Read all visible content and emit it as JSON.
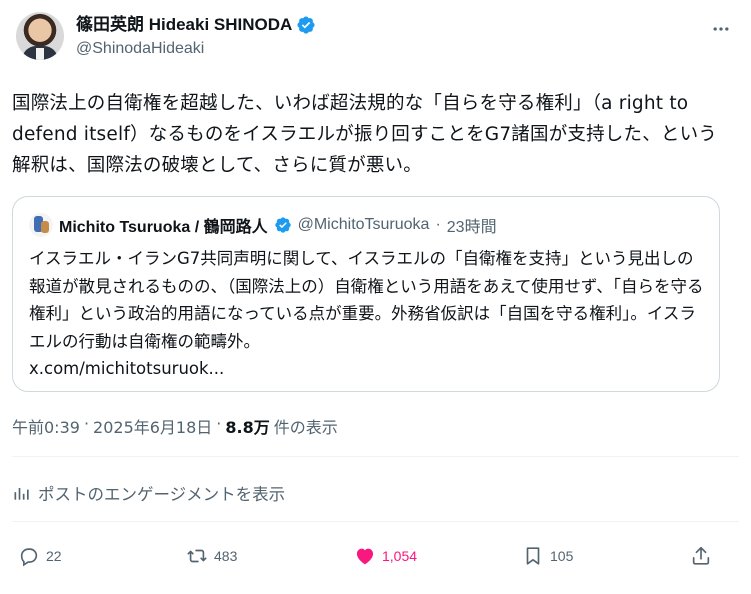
{
  "author": {
    "display_name": "篠田英朗 Hideaki SHINODA",
    "handle": "@ShinodaHideaki"
  },
  "tweet": {
    "text": "国際法上の自衛権を超越した、いわば超法規的な「自らを守る権利」（a right to defend itself）なるものをイスラエルが振り回すことをG7諸国が支持した、という解釈は、国際法の破壊として、さらに質が悪い。"
  },
  "quote": {
    "display_name": "Michito Tsuruoka / 鶴岡路人",
    "handle": "@MichitoTsuruoka",
    "separator": "·",
    "time": "23時間",
    "text": "イスラエル・イランG7共同声明に関して、イスラエルの「自衛権を支持」という見出しの報道が散見されるものの、（国際法上の）自衛権という用語をあえて使用せず、「自らを守る権利」という政治的用語になっている点が重要。外務省仮訳は「自国を守る権利」。イスラエルの行動は自衛権の範疇外。",
    "link": "x.com/michitotsuruok..."
  },
  "meta": {
    "time": "午前0:39",
    "sep1": "·",
    "date": "2025年6月18日",
    "sep2": "·",
    "views": "8.8万",
    "views_label": "件の表示"
  },
  "engagement_link": "ポストのエンゲージメントを表示",
  "actions": {
    "replies": "22",
    "reposts": "483",
    "likes": "1,054",
    "bookmarks": "105"
  },
  "colors": {
    "verified": "#1d9bf0",
    "like": "#f91880",
    "secondary_text": "#536471",
    "border": "#cfd9de"
  }
}
